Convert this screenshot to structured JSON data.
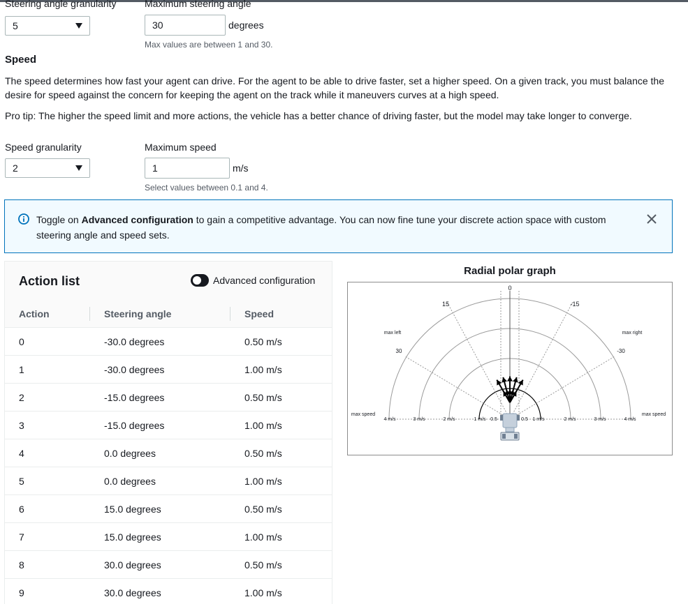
{
  "steering": {
    "granularity_label": "Steering angle granularity",
    "granularity_value": "5",
    "max_label": "Maximum steering angle",
    "max_value": "30",
    "unit": "degrees",
    "hint": "Max values are between 1 and 30."
  },
  "speed": {
    "heading": "Speed",
    "description": "The speed determines how fast your agent can drive. For the agent to be able to drive faster, set a higher speed. On a given track, you must balance the desire for speed against the concern for keeping the agent on the track while it maneuvers curves at a high speed.",
    "pro_tip": "Pro tip: The higher the speed limit and more actions, the vehicle has a better chance of driving faster, but the model may take longer to converge.",
    "granularity_label": "Speed granularity",
    "granularity_value": "2",
    "max_label": "Maximum speed",
    "max_value": "1",
    "unit": "m/s",
    "hint": "Select values between 0.1 and 4."
  },
  "alert": {
    "prefix": "Toggle on ",
    "emphasis": "Advanced configuration",
    "suffix": " to gain a competitive advantage. You can now fine tune your discrete action space with custom steering angle and speed sets."
  },
  "action_list": {
    "title": "Action list",
    "toggle_label": "Advanced configuration",
    "columns": [
      "Action",
      "Steering angle",
      "Speed"
    ],
    "rows": [
      [
        "0",
        "-30.0 degrees",
        "0.50 m/s"
      ],
      [
        "1",
        "-30.0 degrees",
        "1.00 m/s"
      ],
      [
        "2",
        "-15.0 degrees",
        "0.50 m/s"
      ],
      [
        "3",
        "-15.0 degrees",
        "1.00 m/s"
      ],
      [
        "4",
        "0.0 degrees",
        "0.50 m/s"
      ],
      [
        "5",
        "0.0 degrees",
        "1.00 m/s"
      ],
      [
        "6",
        "15.0 degrees",
        "0.50 m/s"
      ],
      [
        "7",
        "15.0 degrees",
        "1.00 m/s"
      ],
      [
        "8",
        "30.0 degrees",
        "0.50 m/s"
      ],
      [
        "9",
        "30.0 degrees",
        "1.00 m/s"
      ]
    ]
  },
  "graph": {
    "title": "Radial polar graph",
    "angle_labels": {
      "zero": "0",
      "left15": "15",
      "right15": "-15",
      "left30": "30",
      "right30": "-30"
    },
    "max_left": "max left",
    "max_right": "max right",
    "max_speed_left": "max speed",
    "max_speed_right": "max speed",
    "speed_ticks_left": [
      "4 m/s",
      "3 m/s",
      "2 m/s",
      "1 m/s",
      "0.5"
    ],
    "speed_ticks_right": [
      "0.5",
      "1 m/s",
      "2 m/s",
      "3 m/s",
      "4 m/s"
    ],
    "actions": [
      {
        "angle": -30,
        "speed": 0.5
      },
      {
        "angle": -30,
        "speed": 1.0
      },
      {
        "angle": -15,
        "speed": 0.5
      },
      {
        "angle": -15,
        "speed": 1.0
      },
      {
        "angle": 0,
        "speed": 0.5
      },
      {
        "angle": 0,
        "speed": 1.0
      },
      {
        "angle": 15,
        "speed": 0.5
      },
      {
        "angle": 15,
        "speed": 1.0
      },
      {
        "angle": 30,
        "speed": 0.5
      },
      {
        "angle": 30,
        "speed": 1.0
      }
    ],
    "colors": {
      "arrow": "#000000",
      "grid": "#9a9a9a",
      "car": "#8fa3b8"
    }
  },
  "colors": {
    "alert_border": "#0073bb",
    "alert_background": "#f1faff",
    "info_icon": "#0073bb"
  }
}
